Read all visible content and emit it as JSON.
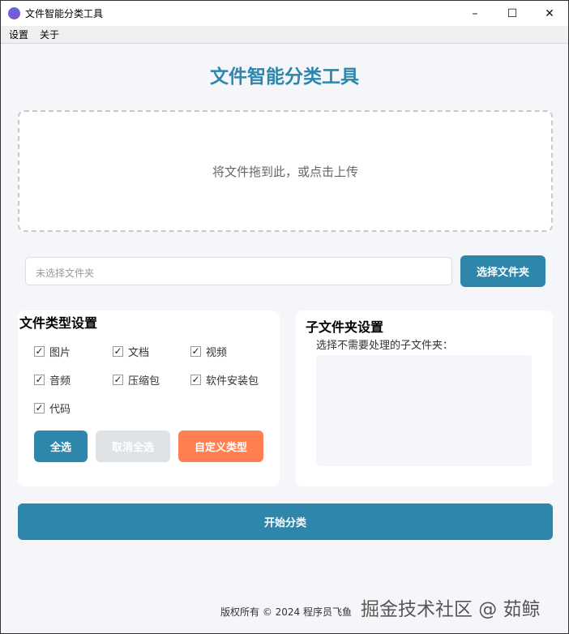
{
  "window": {
    "title": "文件智能分类工具"
  },
  "menu": [
    "设置",
    "关于"
  ],
  "header": {
    "title": "文件智能分类工具"
  },
  "dropzone": {
    "text": "将文件拖到此，或点击上传"
  },
  "folder": {
    "placeholder": "未选择文件夹",
    "button": "选择文件夹"
  },
  "filetypes": {
    "title": "文件类型设置",
    "items": [
      {
        "label": "图片",
        "checked": true
      },
      {
        "label": "文档",
        "checked": true
      },
      {
        "label": "视频",
        "checked": true
      },
      {
        "label": "音频",
        "checked": true
      },
      {
        "label": "压缩包",
        "checked": true
      },
      {
        "label": "软件安装包",
        "checked": true
      },
      {
        "label": "代码",
        "checked": true
      }
    ],
    "select_all": "全选",
    "deselect_all": "取消全选",
    "custom": "自定义类型"
  },
  "subfolders": {
    "title": "子文件夹设置",
    "hint": "选择不需要处理的子文件夹："
  },
  "start_button": "开始分类",
  "footer": "版权所有 © 2024 程序员飞鱼",
  "watermark": "掘金技术社区 @ 茹鲸",
  "colors": {
    "primary": "#2e86ab",
    "orange": "#ff7f50",
    "disabled": "#dfe3e6"
  }
}
